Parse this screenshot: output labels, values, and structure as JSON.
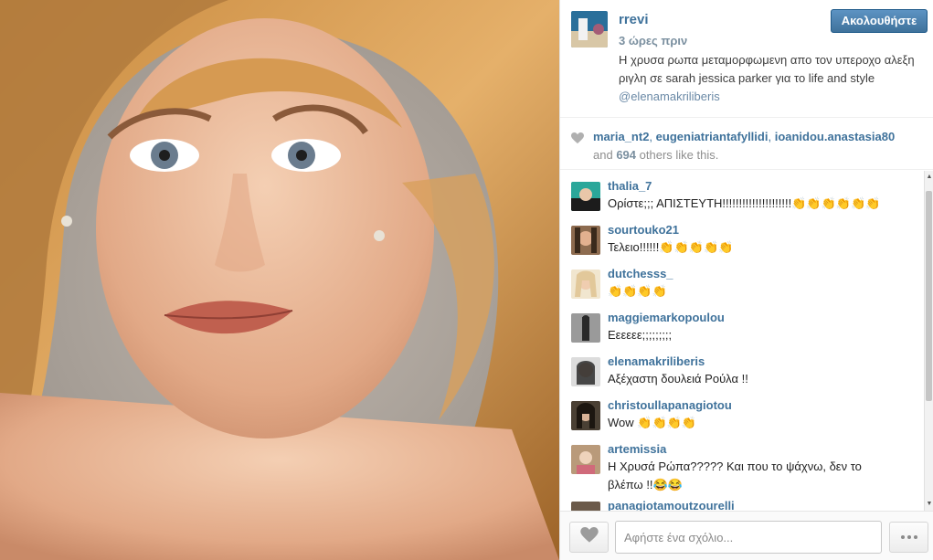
{
  "post": {
    "username": "rrevi",
    "time": "3 ώρες πριν",
    "caption": "Η χρυσα ρωπα μεταμορφωμενη απο τον υπεροχο αλεξη ριγλη σε sarah jessica parker για το life and style",
    "mention": "@elenamakriliberis",
    "follow_label": "Ακολουθήστε"
  },
  "likes": {
    "names": [
      "maria_nt2",
      "eugeniatriantafyllidi",
      "ioanidou.anastasia80"
    ],
    "and_label": "and",
    "count": "694",
    "suffix": "others like this."
  },
  "comments": [
    {
      "user": "thalia_7",
      "text": "Ορίστε;;; ΑΠΙΣΤΕΥΤΗ!!!!!!!!!!!!!!!!!!!!!👏👏👏👏👏👏",
      "avatar_color": "#2aa79a"
    },
    {
      "user": "sourtouko21",
      "text": "Τελειο!!!!!!👏👏👏👏👏",
      "avatar_color": "#8d6b4f"
    },
    {
      "user": "dutchesss_",
      "text": "👏👏👏👏",
      "avatar_color": "#e2c89a"
    },
    {
      "user": "maggiemarkopoulou",
      "text": "Εεεεεε;;;;;;;;;",
      "avatar_color": "#3d3d3d"
    },
    {
      "user": "elenamakriliberis",
      "text": "Αξέχαστη δουλειά Ρούλα !!",
      "avatar_color": "#2b2b2b"
    },
    {
      "user": "christoullapanagiotou",
      "text": "Wow 👏👏👏👏",
      "avatar_color": "#4a4034"
    },
    {
      "user": "artemissia",
      "text": "Η Χρυσά Ρώπα????? Και που το ψάχνω, δεν το βλέπω !!😂😂",
      "avatar_color": "#b99a7a"
    },
    {
      "user": "panagiotamoutzourelli",
      "text": "",
      "avatar_color": "#6b5a4a"
    }
  ],
  "footer": {
    "comment_placeholder": "Αφήστε ένα σχόλιο..."
  },
  "colors": {
    "username_blue": "#3f729b",
    "follow_button": "#3f729b"
  },
  "icons": {
    "like": "heart-icon",
    "more": "ellipsis-icon"
  }
}
